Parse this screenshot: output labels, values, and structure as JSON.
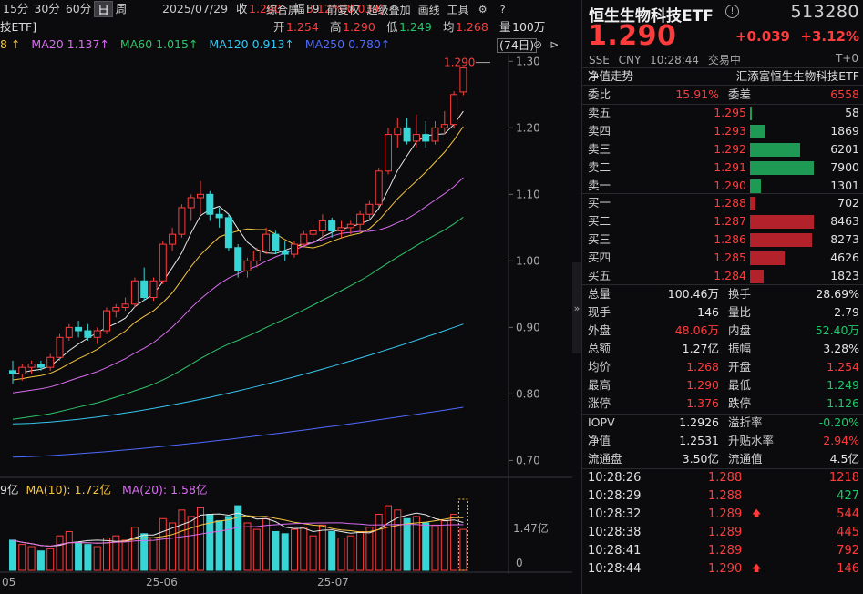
{
  "toolbar": {
    "periods": [
      "15分",
      "30分",
      "60分",
      "日",
      "周"
    ],
    "active_period": "日",
    "date": "2025/07/29",
    "close_label": "收",
    "close": "1.290",
    "amp_label": "幅",
    "amp": "3.12%(0.039)",
    "open_label": "开",
    "open": "1.254",
    "high_label": "高",
    "high": "1.290",
    "low_label": "低",
    "low": "1.249",
    "avg_label": "均",
    "avg": "1.268",
    "vol_label": "量",
    "vol": "100万",
    "right_items": [
      "综合屏",
      "F9",
      "前复权",
      "超级叠加",
      "画线",
      "工具"
    ]
  },
  "chart_title_fragment": "技ETF]",
  "ma_legend": [
    {
      "label": "8",
      "value": "↑",
      "color": "#f5c542"
    },
    {
      "label": "MA20",
      "value": "1.137↑",
      "color": "#d96cf0"
    },
    {
      "label": "MA60",
      "value": "1.015↑",
      "color": "#2fc46a"
    },
    {
      "label": "MA120",
      "value": "0.913↑",
      "color": "#37c6f0"
    },
    {
      "label": "MA250",
      "value": "0.780↑",
      "color": "#4f6bff"
    }
  ],
  "day_count": "(74日)",
  "price_axis": [
    "1.30",
    "1.20",
    "1.10",
    "1.00",
    "0.90",
    "0.80",
    "0.70"
  ],
  "last_price_tag": "1.290",
  "vol_legend": {
    "fragment": "9亿",
    "ma10_label": "MA(10): 1.72亿",
    "ma20_label": "MA(20): 1.58亿"
  },
  "vol_axis": [
    "1.47亿",
    "0"
  ],
  "x_dates": [
    "05",
    "25-06",
    "25-07"
  ],
  "panel": {
    "name": "恒生生物科技ETF",
    "code": "513280",
    "price": "1.290",
    "change": "+0.039",
    "change_pct": "+3.12%",
    "meta": [
      "SSE",
      "CNY",
      "10:28:44",
      "交易中"
    ],
    "t0": "T+0",
    "tab_left": "净值走势",
    "tab_right": "汇添富恒生生物科技ETF",
    "weibi_label": "委比",
    "weibi": "15.91%",
    "weicha_label": "委差",
    "weicha": "6558",
    "asks": [
      {
        "label": "卖五",
        "price": "1.295",
        "vol": "58",
        "ratio": 0.007
      },
      {
        "label": "卖四",
        "price": "1.293",
        "vol": "1869",
        "ratio": 0.236
      },
      {
        "label": "卖三",
        "price": "1.292",
        "vol": "6201",
        "ratio": 0.785
      },
      {
        "label": "卖二",
        "price": "1.291",
        "vol": "7900",
        "ratio": 1.0
      },
      {
        "label": "卖一",
        "price": "1.290",
        "vol": "1301",
        "ratio": 0.165
      }
    ],
    "bids": [
      {
        "label": "买一",
        "price": "1.288",
        "vol": "702",
        "ratio": 0.083
      },
      {
        "label": "买二",
        "price": "1.287",
        "vol": "8463",
        "ratio": 1.0
      },
      {
        "label": "买三",
        "price": "1.286",
        "vol": "8273",
        "ratio": 0.978
      },
      {
        "label": "买四",
        "price": "1.285",
        "vol": "4626",
        "ratio": 0.547
      },
      {
        "label": "买五",
        "price": "1.284",
        "vol": "1823",
        "ratio": 0.215
      }
    ],
    "stats": [
      {
        "l1": "总量",
        "v1": "100.46万",
        "c1": "white",
        "l2": "换手",
        "v2": "28.69%",
        "c2": "white"
      },
      {
        "l1": "现手",
        "v1": "146",
        "c1": "white",
        "l2": "量比",
        "v2": "2.79",
        "c2": "white"
      },
      {
        "l1": "外盘",
        "v1": "48.06万",
        "c1": "red",
        "l2": "内盘",
        "v2": "52.40万",
        "c2": "green"
      },
      {
        "l1": "总额",
        "v1": "1.27亿",
        "c1": "white",
        "l2": "振幅",
        "v2": "3.28%",
        "c2": "white"
      },
      {
        "l1": "均价",
        "v1": "1.268",
        "c1": "red",
        "l2": "开盘",
        "v2": "1.254",
        "c2": "red"
      },
      {
        "l1": "最高",
        "v1": "1.290",
        "c1": "red",
        "l2": "最低",
        "v2": "1.249",
        "c2": "green"
      },
      {
        "l1": "涨停",
        "v1": "1.376",
        "c1": "red",
        "l2": "跌停",
        "v2": "1.126",
        "c2": "green"
      }
    ],
    "stats2": [
      {
        "l1": "IOPV",
        "v1": "1.2926",
        "c1": "white",
        "l2": "溢折率",
        "v2": "-0.20%",
        "c2": "green"
      },
      {
        "l1": "净值",
        "v1": "1.2531",
        "c1": "white",
        "l2": "升贴水率",
        "v2": "2.94%",
        "c2": "red"
      },
      {
        "l1": "流通盘",
        "v1": "3.50亿",
        "c1": "white",
        "l2": "流通值",
        "v2": "4.5亿",
        "c2": "white"
      }
    ],
    "ticks": [
      {
        "time": "10:28:26",
        "price": "1.288",
        "arrow": "",
        "vol": "1218",
        "color": "red"
      },
      {
        "time": "10:28:29",
        "price": "1.288",
        "arrow": "",
        "vol": "427",
        "color": "green"
      },
      {
        "time": "10:28:32",
        "price": "1.289",
        "arrow": "🡅",
        "vol": "544",
        "color": "red"
      },
      {
        "time": "10:28:38",
        "price": "1.289",
        "arrow": "",
        "vol": "445",
        "color": "red"
      },
      {
        "time": "10:28:41",
        "price": "1.289",
        "arrow": "",
        "vol": "792",
        "color": "red"
      },
      {
        "time": "10:28:44",
        "price": "1.290",
        "arrow": "🡅",
        "vol": "146",
        "color": "red"
      }
    ]
  },
  "chart_data": {
    "type": "candlestick",
    "ylim": [
      0.68,
      1.31
    ],
    "candles": [
      [
        0.835,
        0.85,
        0.815,
        0.83
      ],
      [
        0.83,
        0.845,
        0.82,
        0.84
      ],
      [
        0.84,
        0.85,
        0.83,
        0.845
      ],
      [
        0.845,
        0.85,
        0.835,
        0.84
      ],
      [
        0.84,
        0.86,
        0.835,
        0.855
      ],
      [
        0.855,
        0.89,
        0.85,
        0.885
      ],
      [
        0.885,
        0.905,
        0.88,
        0.9
      ],
      [
        0.9,
        0.91,
        0.885,
        0.895
      ],
      [
        0.895,
        0.905,
        0.88,
        0.885
      ],
      [
        0.885,
        0.9,
        0.875,
        0.895
      ],
      [
        0.895,
        0.93,
        0.89,
        0.925
      ],
      [
        0.925,
        0.935,
        0.915,
        0.93
      ],
      [
        0.93,
        0.945,
        0.925,
        0.935
      ],
      [
        0.935,
        0.975,
        0.93,
        0.97
      ],
      [
        0.97,
        0.99,
        0.94,
        0.945
      ],
      [
        0.945,
        0.975,
        0.94,
        0.97
      ],
      [
        0.97,
        1.03,
        0.965,
        1.025
      ],
      [
        1.025,
        1.05,
        1.015,
        1.04
      ],
      [
        1.04,
        1.085,
        1.035,
        1.08
      ],
      [
        1.08,
        1.1,
        1.06,
        1.095
      ],
      [
        1.095,
        1.12,
        1.07,
        1.1
      ],
      [
        1.1,
        1.105,
        1.06,
        1.07
      ],
      [
        1.07,
        1.08,
        1.05,
        1.065
      ],
      [
        1.065,
        1.07,
        1.015,
        1.02
      ],
      [
        1.02,
        1.025,
        0.975,
        0.985
      ],
      [
        0.985,
        1.005,
        0.975,
        1.0
      ],
      [
        1.0,
        1.02,
        0.99,
        1.015
      ],
      [
        1.015,
        1.05,
        1.01,
        1.04
      ],
      [
        1.04,
        1.045,
        1.01,
        1.015
      ],
      [
        1.015,
        1.03,
        1.0,
        1.01
      ],
      [
        1.01,
        1.03,
        1.005,
        1.025
      ],
      [
        1.025,
        1.045,
        1.02,
        1.04
      ],
      [
        1.04,
        1.055,
        1.03,
        1.045
      ],
      [
        1.045,
        1.07,
        1.035,
        1.06
      ],
      [
        1.06,
        1.065,
        1.035,
        1.045
      ],
      [
        1.045,
        1.06,
        1.035,
        1.05
      ],
      [
        1.05,
        1.06,
        1.04,
        1.055
      ],
      [
        1.055,
        1.075,
        1.045,
        1.07
      ],
      [
        1.07,
        1.09,
        1.06,
        1.085
      ],
      [
        1.085,
        1.14,
        1.08,
        1.135
      ],
      [
        1.135,
        1.2,
        1.13,
        1.19
      ],
      [
        1.19,
        1.215,
        1.17,
        1.2
      ],
      [
        1.2,
        1.215,
        1.175,
        1.18
      ],
      [
        1.18,
        1.22,
        1.17,
        1.19
      ],
      [
        1.19,
        1.21,
        1.17,
        1.18
      ],
      [
        1.18,
        1.21,
        1.175,
        1.2
      ],
      [
        1.2,
        1.225,
        1.19,
        1.205
      ],
      [
        1.205,
        1.255,
        1.2,
        1.25
      ],
      [
        1.254,
        1.29,
        1.249,
        1.29
      ]
    ],
    "volumes": [
      1.4,
      1.2,
      1.1,
      0.9,
      1.0,
      1.6,
      1.8,
      1.3,
      1.2,
      1.1,
      1.5,
      1.6,
      1.4,
      2.0,
      1.7,
      1.5,
      2.4,
      2.2,
      2.8,
      2.5,
      2.9,
      2.6,
      2.3,
      2.5,
      3.0,
      2.2,
      1.9,
      2.4,
      1.8,
      1.7,
      1.9,
      2.0,
      1.6,
      2.1,
      1.8,
      1.5,
      1.6,
      1.8,
      2.0,
      2.6,
      3.0,
      2.8,
      2.4,
      2.5,
      2.2,
      2.1,
      2.3,
      2.6,
      1.9
    ],
    "vol_ylim": [
      0,
      3.3
    ]
  }
}
